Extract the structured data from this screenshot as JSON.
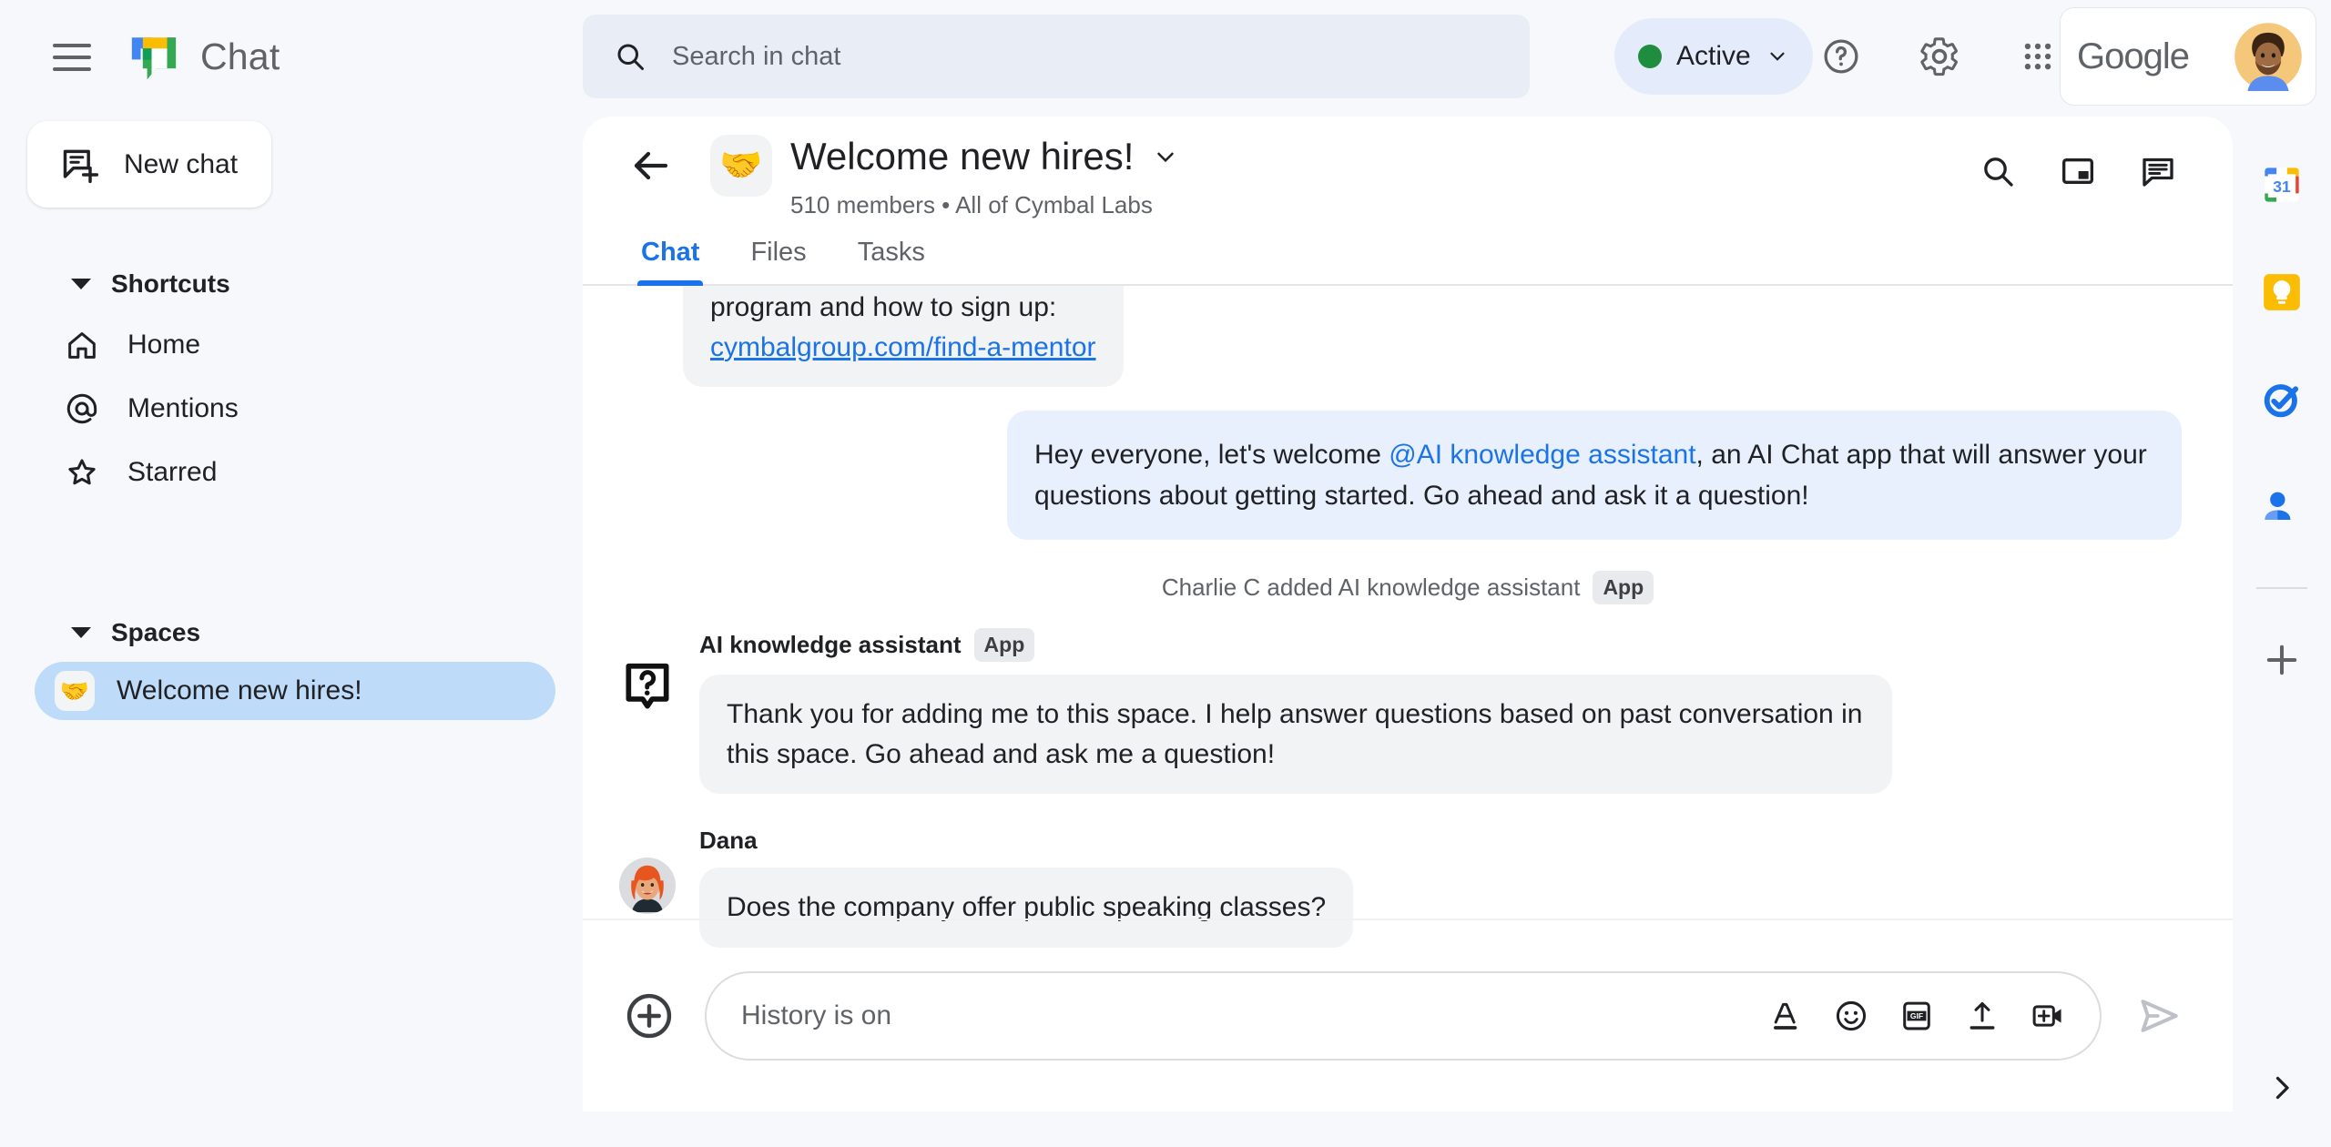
{
  "app": {
    "brand_name": "Chat",
    "menu_icon": "hamburger-icon",
    "logo_icon": "google-chat-logo"
  },
  "search": {
    "placeholder": "Search in chat",
    "icon": "search-icon"
  },
  "topbar": {
    "status_label": "Active",
    "status_color": "#1e8e3e",
    "status_chevron": "chevron-down-icon",
    "help_icon": "help-icon",
    "settings_icon": "gear-icon",
    "apps_icon": "apps-grid-icon",
    "google_word": "Google",
    "avatar_icon": "user-avatar"
  },
  "sidebar": {
    "new_chat_label": "New chat",
    "new_chat_icon": "new-chat-icon",
    "shortcuts": {
      "title": "Shortcuts",
      "items": [
        {
          "label": "Home",
          "icon": "home-icon"
        },
        {
          "label": "Mentions",
          "icon": "at-icon"
        },
        {
          "label": "Starred",
          "icon": "star-icon"
        }
      ]
    },
    "spaces": {
      "title": "Spaces",
      "items": [
        {
          "label": "Welcome new hires!",
          "emoji": "🤝",
          "selected": true
        }
      ]
    }
  },
  "space": {
    "back_icon": "back-arrow-icon",
    "emoji": "🤝",
    "title": "Welcome new hires!",
    "title_chevron": "chevron-down-icon",
    "members": "510 members",
    "separator": "•",
    "org": "All of Cymbal Labs",
    "subtitle": "510 members  •  All of Cymbal Labs",
    "actions": [
      {
        "name": "search-in-space-icon"
      },
      {
        "name": "picture-in-picture-icon"
      },
      {
        "name": "chat-summary-icon"
      }
    ],
    "tabs": [
      {
        "label": "Chat",
        "active": true
      },
      {
        "label": "Files",
        "active": false
      },
      {
        "label": "Tasks",
        "active": false
      }
    ]
  },
  "messages": {
    "truncated": {
      "text_line1": "program and how to sign up:",
      "link": "cymbalgroup.com/find-a-mentor"
    },
    "outgoing": {
      "prefix": "Hey everyone, let's welcome ",
      "mention": "@AI knowledge assistant",
      "suffix": ", an AI Chat app that will answer your questions about getting started.  Go ahead and ask it a question!"
    },
    "system": {
      "text": "Charlie C added AI knowledge assistant",
      "badge": "App"
    },
    "assistant": {
      "name": "AI knowledge assistant",
      "badge": "App",
      "avatar_icon": "question-bubble-icon",
      "text": "Thank you for adding me to this space. I help answer questions based on past conversation in this space. Go ahead and ask me a question!"
    },
    "dana": {
      "name": "Dana",
      "avatar_icon": "dana-avatar",
      "text": "Does the company offer public speaking classes?"
    }
  },
  "compose": {
    "plus_icon": "add-icon",
    "placeholder": "History is on",
    "icons": [
      {
        "name": "format-text-icon",
        "glyph": "A"
      },
      {
        "name": "emoji-icon"
      },
      {
        "name": "gif-icon",
        "glyph": "GIF"
      },
      {
        "name": "upload-icon"
      },
      {
        "name": "video-add-icon"
      }
    ],
    "send_icon": "send-icon"
  },
  "rail": {
    "items": [
      {
        "name": "google-calendar-icon",
        "label": "31"
      },
      {
        "name": "google-keep-icon"
      },
      {
        "name": "google-tasks-icon"
      },
      {
        "name": "google-contacts-icon"
      }
    ],
    "add_icon": "add-icon",
    "expand_icon": "chevron-right-icon"
  },
  "colors": {
    "page_bg": "#f6f8fc",
    "panel_bg": "#ffffff",
    "accent_blue": "#1a73e8",
    "bubble_in": "#f1f3f4",
    "bubble_out": "#e8f0fe",
    "space_selected": "#bedbfa",
    "search_bg": "#e9eef6"
  }
}
